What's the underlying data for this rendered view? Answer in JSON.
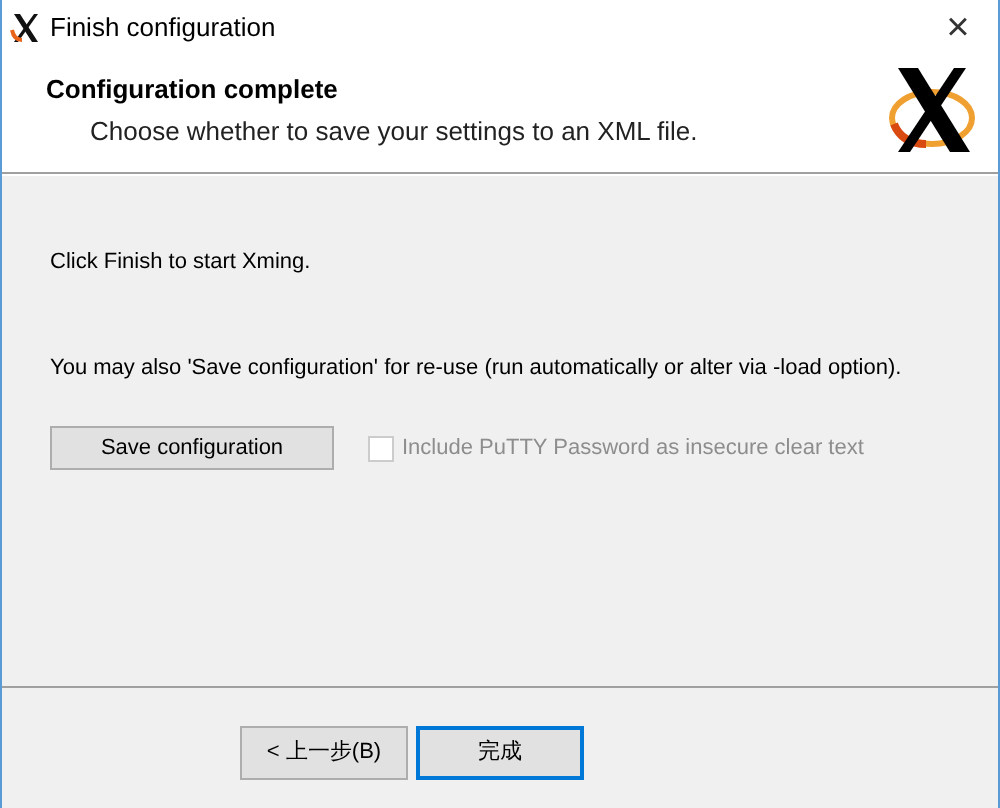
{
  "window": {
    "title": "Finish configuration",
    "close": "×"
  },
  "header": {
    "title": "Configuration complete",
    "subtitle": "Choose whether to save your settings to an XML file."
  },
  "body": {
    "instruction": "Click Finish to start Xming.",
    "note": "You may also 'Save configuration' for re-use (run automatically or alter via -load option).",
    "save_button": "Save configuration",
    "checkbox": {
      "label": "Include PuTTY Password as insecure clear text",
      "checked": false,
      "disabled": true
    }
  },
  "buttons": [
    {
      "label": "< 上一步(B)",
      "selected": false
    },
    {
      "label": "完成",
      "selected": true
    }
  ]
}
